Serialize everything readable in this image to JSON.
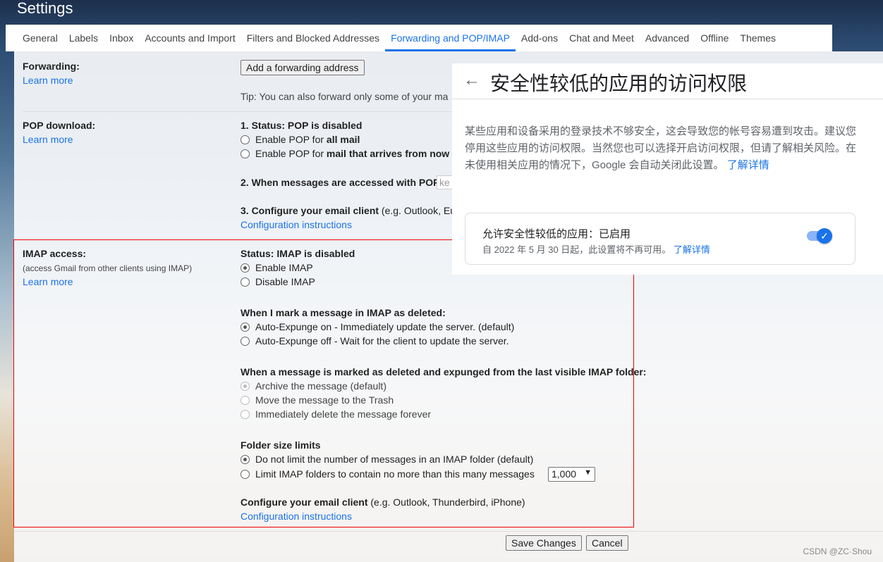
{
  "header": {
    "title": "Settings"
  },
  "tabs": [
    {
      "label": "General"
    },
    {
      "label": "Labels"
    },
    {
      "label": "Inbox"
    },
    {
      "label": "Accounts and Import"
    },
    {
      "label": "Filters and Blocked Addresses"
    },
    {
      "label": "Forwarding and POP/IMAP",
      "active": true
    },
    {
      "label": "Add-ons"
    },
    {
      "label": "Chat and Meet"
    },
    {
      "label": "Advanced"
    },
    {
      "label": "Offline"
    },
    {
      "label": "Themes"
    }
  ],
  "forwarding": {
    "label": "Forwarding:",
    "learn_more": "Learn more",
    "add_button": "Add a forwarding address",
    "tip": "Tip: You can also forward only some of your ma"
  },
  "pop": {
    "label": "POP download:",
    "learn_more": "Learn more",
    "status": "1. Status: POP is disabled",
    "opt1_prefix": "Enable POP for ",
    "opt1_bold": "all mail",
    "opt2_prefix": "Enable POP for ",
    "opt2_bold": "mail that arrives from now o",
    "step2": "2. When messages are accessed with POP",
    "step2_input": "ke",
    "step3_bold": "3. Configure your email client",
    "step3_rest": " (e.g. Outlook, Eu",
    "config_link": "Configuration instructions"
  },
  "imap": {
    "label": "IMAP access:",
    "sublabel": "(access Gmail from other clients using IMAP)",
    "learn_more": "Learn more",
    "status": "Status: IMAP is disabled",
    "enable": "Enable IMAP",
    "disable": "Disable IMAP",
    "deleted_heading": "When I mark a message in IMAP as deleted:",
    "expunge_on": "Auto-Expunge on - Immediately update the server. (default)",
    "expunge_off": "Auto-Expunge off - Wait for the client to update the server.",
    "expunged_heading": "When a message is marked as deleted and expunged from the last visible IMAP folder:",
    "archive": "Archive the message (default)",
    "trash": "Move the message to the Trash",
    "delete_forever": "Immediately delete the message forever",
    "folder_heading": "Folder size limits",
    "no_limit": "Do not limit the number of messages in an IMAP folder (default)",
    "limit": "Limit IMAP folders to contain no more than this many messages",
    "limit_value": "1,000",
    "configure_bold": "Configure your email client",
    "configure_rest": " (e.g. Outlook, Thunderbird, iPhone)",
    "config_link": "Configuration instructions"
  },
  "footer": {
    "save": "Save Changes",
    "cancel": "Cancel"
  },
  "panel": {
    "title": "安全性较低的应用的访问权限",
    "body": "某些应用和设备采用的登录技术不够安全，这会导致您的帐号容易遭到攻击。建议您停用这些应用的访问权限。当然您也可以选择开启访问权限，但请了解相关风险。在未使用相关应用的情况下，Google 会自动关闭此设置。",
    "body_link": "了解详情",
    "card_title": "允许安全性较低的应用：已启用",
    "card_sub": "自 2022 年 5 月 30 日起，此设置将不再可用。",
    "card_link": "了解详情",
    "toggle_on": true
  },
  "watermark": "CSDN @ZC·Shou",
  "colors": {
    "accent": "#1a73e8",
    "highlight_box": "#e00000"
  }
}
